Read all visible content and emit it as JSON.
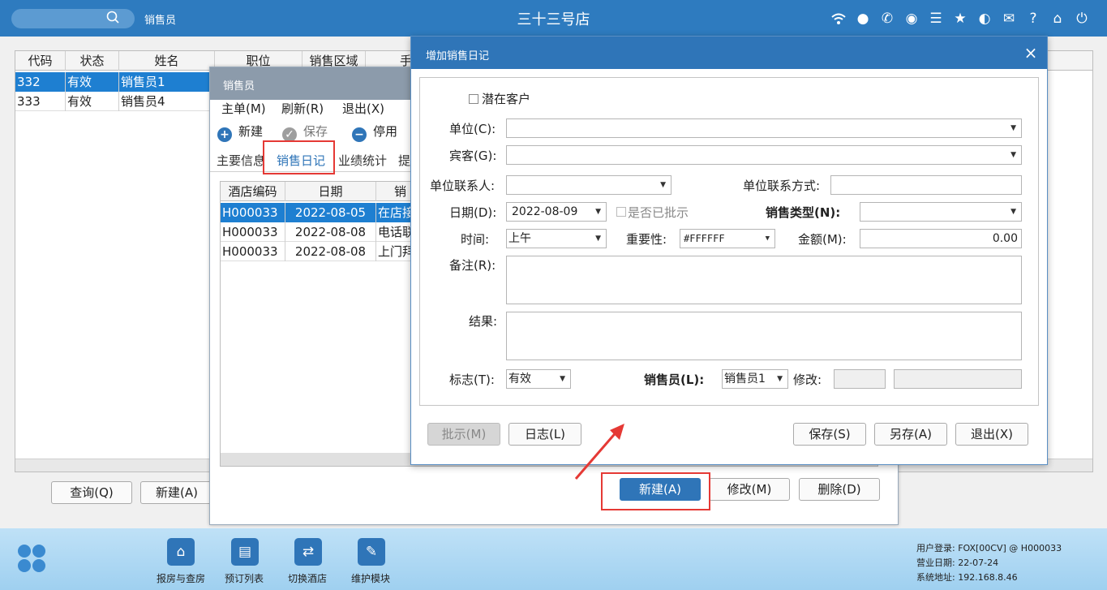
{
  "topbar": {
    "module_title": "销售员",
    "hotel_name": "三十三号店",
    "icons": [
      "wifi-icon",
      "chat-icon",
      "phone-icon",
      "palette-icon",
      "menu-icon",
      "star-icon",
      "theme-icon",
      "mail-icon",
      "help-icon",
      "home-icon",
      "power-icon"
    ]
  },
  "main_grid": {
    "columns": [
      "代码",
      "状态",
      "姓名",
      "职位",
      "销售区域",
      "手"
    ],
    "rows": [
      {
        "code": "332",
        "status": "有效",
        "name": "销售员1"
      },
      {
        "code": "333",
        "status": "有效",
        "name": "销售员4"
      }
    ]
  },
  "main_buttons": {
    "query": "查询(Q)",
    "new": "新建(A)"
  },
  "sp_window": {
    "title": "销售员",
    "menu": [
      "主单(M)",
      "刷新(R)",
      "退出(X)"
    ],
    "toolbar": {
      "new": "新建",
      "save": "保存",
      "disable": "停用"
    },
    "tabs": [
      "主要信息",
      "销售日记",
      "业绩统计",
      "提"
    ],
    "grid_columns": [
      "酒店编码",
      "日期",
      "销"
    ],
    "grid_rows": [
      {
        "hotel": "H000033",
        "date": "2022-08-05",
        "type": "在店接"
      },
      {
        "hotel": "H000033",
        "date": "2022-08-08",
        "type": "电话联"
      },
      {
        "hotel": "H000033",
        "date": "2022-08-08",
        "type": "上门拜"
      }
    ],
    "buttons": {
      "new": "新建(A)",
      "modify": "修改(M)",
      "delete": "删除(D)"
    }
  },
  "log_dialog": {
    "title": "增加销售日记",
    "close": "×",
    "potential_customer": "潜在客户",
    "labels": {
      "unit": "单位(C):",
      "guest": "宾客(G):",
      "unit_contact": "单位联系人:",
      "unit_contact_method": "单位联系方式:",
      "date": "日期(D):",
      "approved": "是否已批示",
      "sales_type": "销售类型(N):",
      "time": "时间:",
      "importance": "重要性:",
      "amount": "金额(M):",
      "remark": "备注(R):",
      "result": "结果:",
      "flag": "标志(T):",
      "salesperson": "销售员(L):",
      "modify": "修改:"
    },
    "values": {
      "date": "2022-08-09",
      "time": "上午",
      "importance": "#FFFFFF",
      "amount": "0.00",
      "flag": "有效",
      "salesperson": "销售员1"
    },
    "buttons": {
      "approve": "批示(M)",
      "log": "日志(L)",
      "save": "保存(S)",
      "save_as": "另存(A)",
      "exit": "退出(X)"
    }
  },
  "footer": {
    "tiles": [
      "报房与查房",
      "预订列表",
      "切换酒店",
      "维护模块"
    ],
    "info": [
      "用户登录: FOX[00CV] @ H000033",
      "营业日期: 22-07-24",
      "系统地址: 192.168.8.46"
    ]
  },
  "colors": {
    "primary": "#2f75b8",
    "selected_row": "#1e7fd1",
    "highlight": "#e53935"
  }
}
